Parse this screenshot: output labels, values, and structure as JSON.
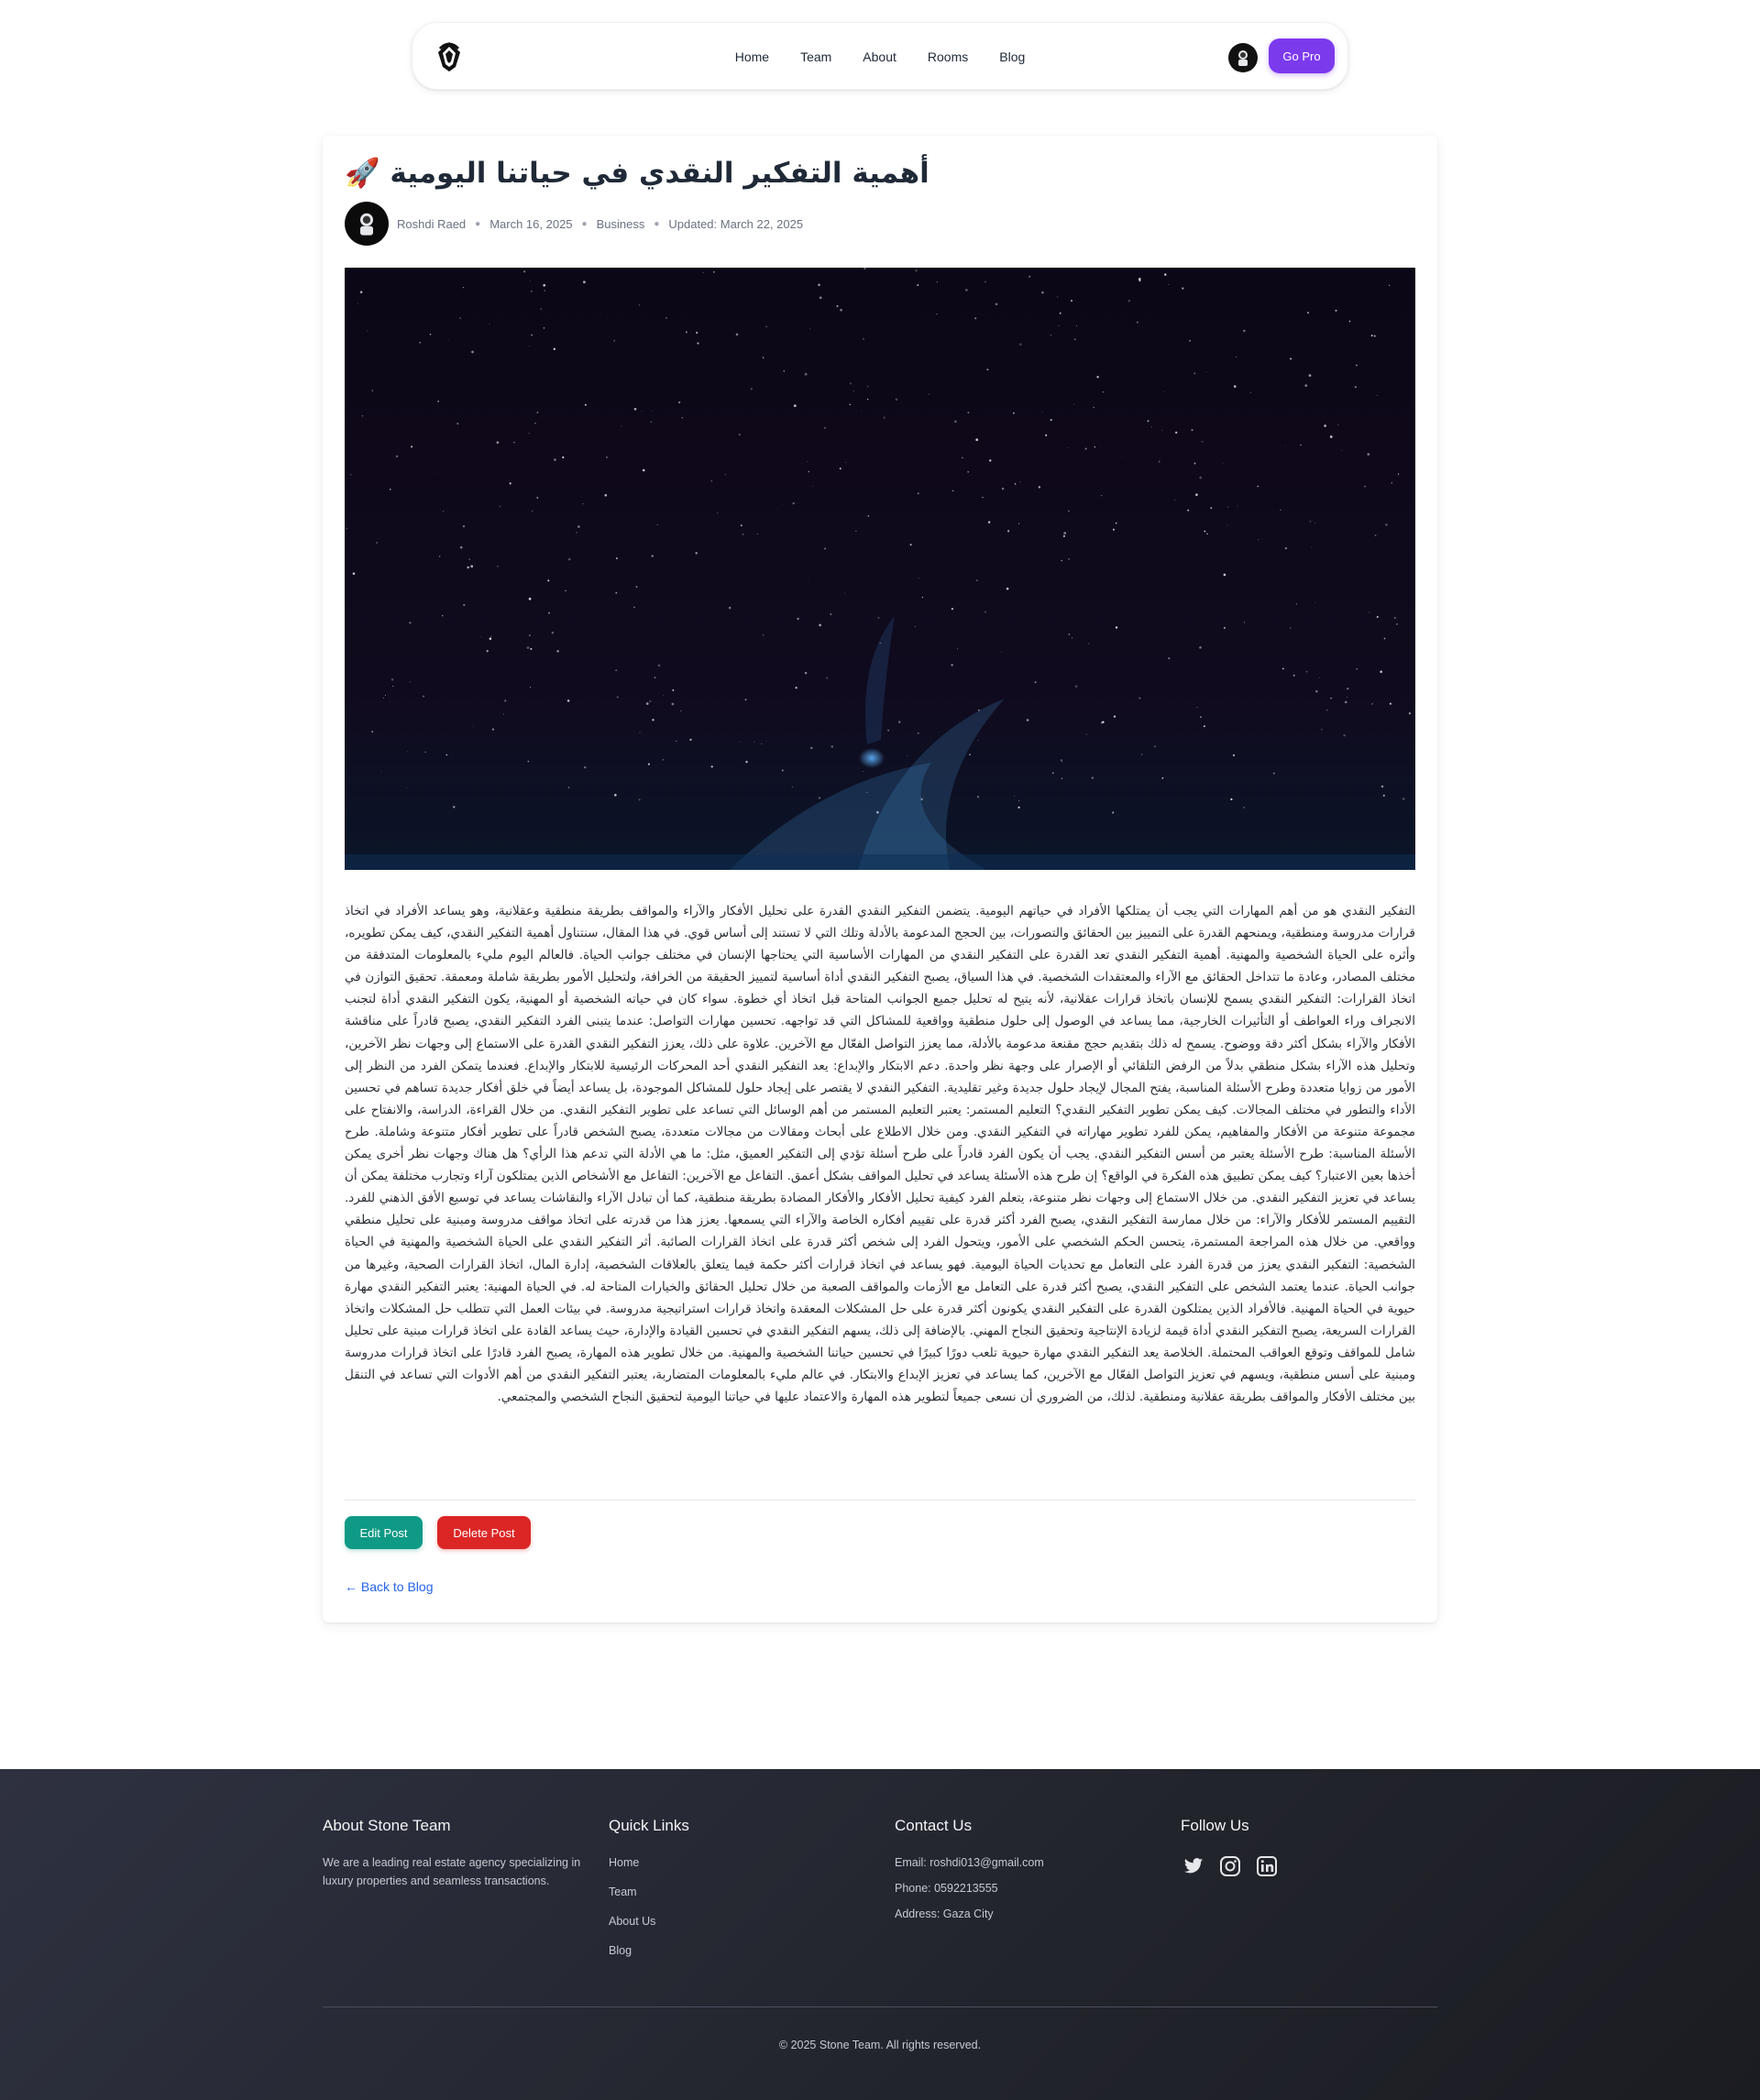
{
  "nav": {
    "links": [
      "Home",
      "Team",
      "About",
      "Rooms",
      "Blog"
    ],
    "cta_label": "Go Pro",
    "accent_color": "#7c3aed",
    "logo_icon": "gem-logo-icon",
    "avatar_icon": "astronaut-avatar-icon"
  },
  "post": {
    "title": "أهمية التفكير النقدي في حياتنا اليومية 🚀",
    "author": "Roshdi Raed",
    "date": "March 16, 2025",
    "category": "Business",
    "updated": "Updated: March 22, 2025",
    "hero_image": "starfield-space-image",
    "body": "التفكير النقدي هو من أهم المهارات التي يجب أن يمتلكها الأفراد في حياتهم اليومية. يتضمن التفكير النقدي القدرة على تحليل الأفكار والآراء والمواقف بطريقة منطقية وعقلانية، وهو يساعد الأفراد في اتخاذ قرارات مدروسة ومنطقية، ويمنحهم القدرة على التمييز بين الحقائق والتصورات، بين الحجج المدعومة بالأدلة وتلك التي لا تستند إلى أساس قوي. في هذا المقال، سنتناول أهمية التفكير النقدي، كيف يمكن تطويره، وأثره على الحياة الشخصية والمهنية. أهمية التفكير النقدي تعد القدرة على التفكير النقدي من المهارات الأساسية التي يحتاجها الإنسان في مختلف جوانب الحياة. فالعالم اليوم مليء بالمعلومات المتدفقة من مختلف المصادر، وعادة ما تتداخل الحقائق مع الآراء والمعتقدات الشخصية. في هذا السياق، يصبح التفكير النقدي أداة أساسية لتمييز الحقيقة من الخرافة، ولتحليل الأمور بطريقة شاملة ومعمقة. تحقيق التوازن في اتخاذ القرارات: التفكير النقدي يسمح للإنسان باتخاذ قرارات عقلانية، لأنه يتيح له تحليل جميع الجوانب المتاحة قبل اتخاذ أي خطوة. سواء كان في حياته الشخصية أو المهنية، يكون التفكير النقدي أداة لتجنب الانجراف وراء العواطف أو التأثيرات الخارجية، مما يساعد في الوصول إلى حلول منطقية وواقعية للمشاكل التي قد تواجهه. تحسين مهارات التواصل: عندما يتبنى الفرد التفكير النقدي، يصبح قادراً على مناقشة الأفكار والآراء بشكل أكثر دقة ووضوح. يسمح له ذلك بتقديم حجج مقنعة مدعومة بالأدلة، مما يعزز التواصل الفعّال مع الآخرين. علاوة على ذلك، يعزز التفكير النقدي القدرة على الاستماع إلى وجهات نظر الآخرين، وتحليل هذه الآراء بشكل منطقي بدلاً من الرفض التلقائي أو الإصرار على وجهة نظر واحدة. دعم الابتكار والإبداع: يعد التفكير النقدي أحد المحركات الرئيسية للابتكار والإبداع. فعندما يتمكن الفرد من النظر إلى الأمور من زوايا متعددة وطرح الأسئلة المناسبة، يفتح المجال لإيجاد حلول جديدة وغير تقليدية. التفكير النقدي لا يقتصر على إيجاد حلول للمشاكل الموجودة، بل يساعد أيضاً في خلق أفكار جديدة تساهم في تحسين الأداء والتطور في مختلف المجالات. كيف يمكن تطوير التفكير النقدي؟ التعليم المستمر: يعتبر التعليم المستمر من أهم الوسائل التي تساعد على تطوير التفكير النقدي. من خلال القراءة، الدراسة، والانفتاح على مجموعة متنوعة من الأفكار والمفاهيم، يمكن للفرد تطوير مهاراته في التفكير النقدي. ومن خلال الاطلاع على أبحاث ومقالات من مجالات متعددة، يصبح الشخص قادراً على تطوير أفكار متنوعة وشاملة. طرح الأسئلة المناسبة: طرح الأسئلة يعتبر من أسس التفكير النقدي. يجب أن يكون الفرد قادراً على طرح أسئلة تؤدي إلى التفكير العميق، مثل: ما هي الأدلة التي تدعم هذا الرأي؟ هل هناك وجهات نظر أخرى يمكن أخذها بعين الاعتبار؟ كيف يمكن تطبيق هذه الفكرة في الواقع؟ إن طرح هذه الأسئلة يساعد في تحليل المواقف بشكل أعمق. التفاعل مع الآخرين: التفاعل مع الأشخاص الذين يمتلكون آراء وتجارب مختلفة يمكن أن يساعد في تعزيز التفكير النقدي. من خلال الاستماع إلى وجهات نظر متنوعة، يتعلم الفرد كيفية تحليل الأفكار والأفكار المضادة بطريقة منطقية، كما أن تبادل الآراء والنقاشات يساعد في توسيع الأفق الذهني للفرد. التقييم المستمر للأفكار والآراء: من خلال ممارسة التفكير النقدي، يصبح الفرد أكثر قدرة على تقييم أفكاره الخاصة والآراء التي يسمعها. يعزز هذا من قدرته على اتخاذ مواقف مدروسة ومبنية على تحليل منطقي وواقعي. من خلال هذه المراجعة المستمرة، يتحسن الحكم الشخصي على الأمور، ويتحول الفرد إلى شخص أكثر قدرة على اتخاذ القرارات الصائبة. أثر التفكير النقدي على الحياة الشخصية والمهنية في الحياة الشخصية: التفكير النقدي يعزز من قدرة الفرد على التعامل مع تحديات الحياة اليومية. فهو يساعد في اتخاذ قرارات أكثر حكمة فيما يتعلق بالعلاقات الشخصية، إدارة المال، اتخاذ القرارات الصحية، وغيرها من جوانب الحياة. عندما يعتمد الشخص على التفكير النقدي، يصبح أكثر قدرة على التعامل مع الأزمات والمواقف الصعبة من خلال تحليل الحقائق والخيارات المتاحة له. في الحياة المهنية: يعتبر التفكير النقدي مهارة حيوية في الحياة المهنية. فالأفراد الذين يمتلكون القدرة على التفكير النقدي يكونون أكثر قدرة على حل المشكلات المعقدة واتخاذ قرارات استراتيجية مدروسة. في بيئات العمل التي تتطلب حل المشكلات واتخاذ القرارات السريعة، يصبح التفكير النقدي أداة قيمة لزيادة الإنتاجية وتحقيق النجاح المهني. بالإضافة إلى ذلك، يسهم التفكير النقدي في تحسين القيادة والإدارة، حيث يساعد القادة على اتخاذ قرارات مبنية على تحليل شامل للمواقف وتوقع العواقب المحتملة. الخلاصة يعد التفكير النقدي مهارة حيوية تلعب دورًا كبيرًا في تحسين حياتنا الشخصية والمهنية. من خلال تطوير هذه المهارة، يصبح الفرد قادرًا على اتخاذ قرارات مدروسة ومبنية على أسس منطقية، ويسهم في تعزيز التواصل الفعّال مع الآخرين، كما يساعد في تعزيز الإبداع والابتكار. في عالم مليء بالمعلومات المتضاربة، يعتبر التفكير النقدي من أهم الأدوات التي تساعد في التنقل بين مختلف الأفكار والمواقف بطريقة عقلانية ومنطقية. لذلك، من الضروري أن نسعى جميعاً لتطوير هذه المهارة والاعتماد عليها في حياتنا اليومية لتحقيق النجاح الشخصي والمجتمعي.",
    "edit_label": "Edit Post",
    "delete_label": "Delete Post",
    "back_label": "← Back to Blog",
    "edit_color": "#0f9a86",
    "delete_color": "#dc2626"
  },
  "footer": {
    "about_title": "About Stone Team",
    "about_text": "We are a leading real estate agency specializing in luxury properties and seamless transactions.",
    "links_title": "Quick Links",
    "links": [
      "Home",
      "Team",
      "About Us",
      "Blog"
    ],
    "contact_title": "Contact Us",
    "email": "Email: roshdi013@gmail.com",
    "phone": "Phone: 0592213555",
    "address": "Address: Gaza City",
    "follow_title": "Follow Us",
    "social_icons": [
      "twitter-icon",
      "instagram-icon",
      "linkedin-icon"
    ],
    "copyright": "© 2025 Stone Team. All rights reserved."
  }
}
